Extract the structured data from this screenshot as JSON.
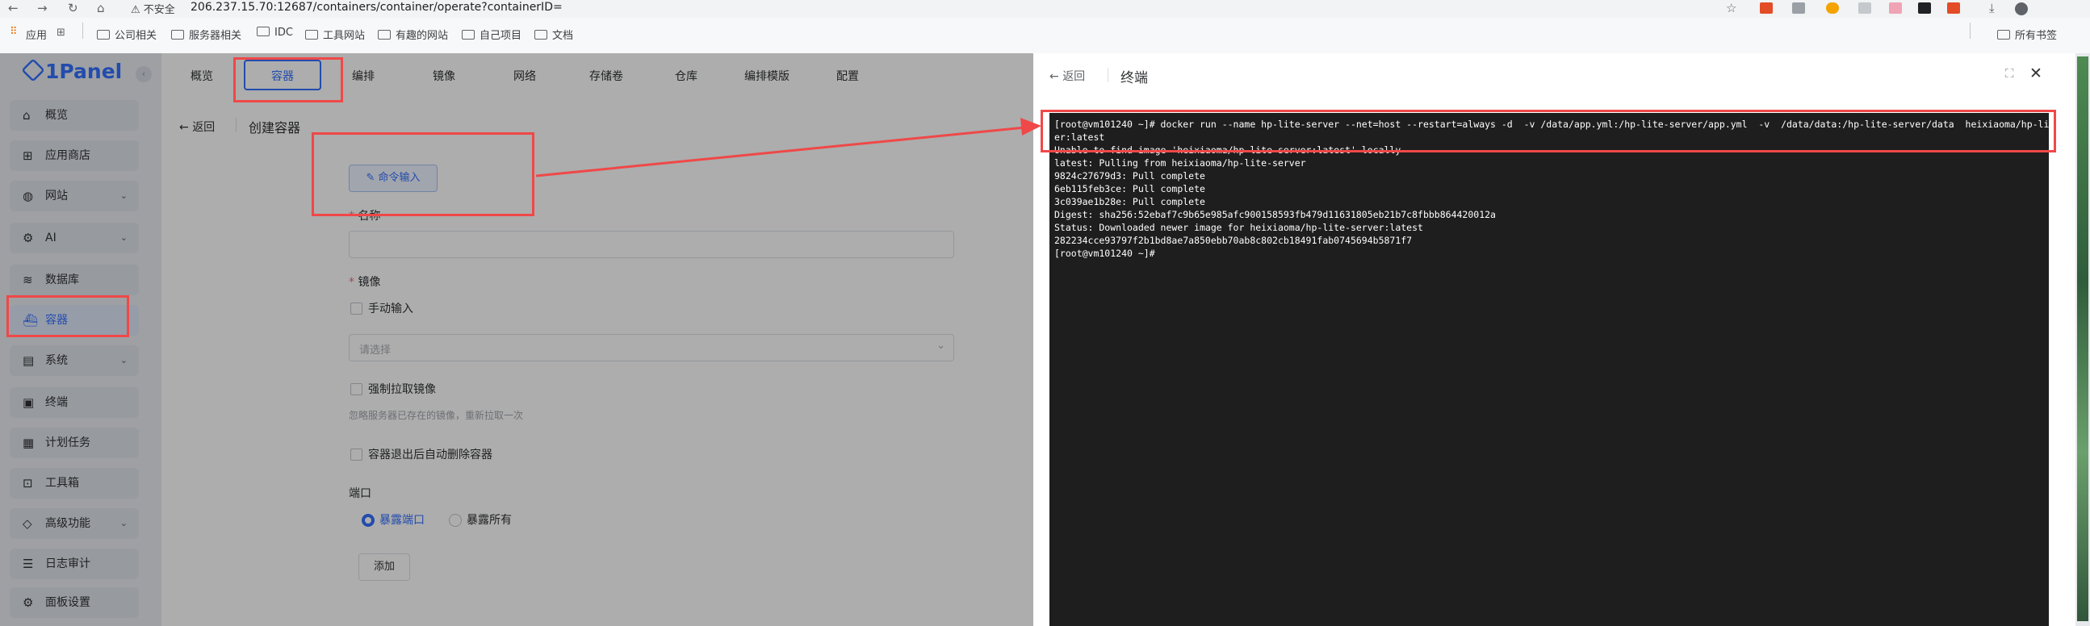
{
  "browser": {
    "insecure_label": "不安全",
    "url": "206.237.15.70:12687/containers/container/operate?containerID=",
    "bookmarks": [
      "应用",
      "公司相关",
      "服务器相关",
      "IDC",
      "工具网站",
      "有趣的网站",
      "自己项目",
      "文档"
    ],
    "all_bookmarks": "所有书签"
  },
  "sidebar": {
    "logo": "1Panel",
    "items": [
      {
        "label": "概览",
        "icon": "home-icon",
        "chevron": false
      },
      {
        "label": "应用商店",
        "icon": "apps-icon",
        "chevron": false
      },
      {
        "label": "网站",
        "icon": "globe-icon",
        "chevron": true
      },
      {
        "label": "AI",
        "icon": "robot-icon",
        "chevron": true
      },
      {
        "label": "数据库",
        "icon": "layers-icon",
        "chevron": false
      },
      {
        "label": "容器",
        "icon": "docker-icon",
        "chevron": false,
        "active": true
      },
      {
        "label": "系统",
        "icon": "system-icon",
        "chevron": true
      },
      {
        "label": "终端",
        "icon": "terminal-icon",
        "chevron": false
      },
      {
        "label": "计划任务",
        "icon": "calendar-icon",
        "chevron": false
      },
      {
        "label": "工具箱",
        "icon": "toolbox-icon",
        "chevron": false
      },
      {
        "label": "高级功能",
        "icon": "diamond-icon",
        "chevron": true
      },
      {
        "label": "日志审计",
        "icon": "log-icon",
        "chevron": false
      },
      {
        "label": "面板设置",
        "icon": "settings-icon",
        "chevron": false
      }
    ]
  },
  "tabs": [
    "概览",
    "容器",
    "编排",
    "镜像",
    "网络",
    "存储卷",
    "仓库",
    "编排模版",
    "配置"
  ],
  "page": {
    "back": "返回",
    "title": "创建容器",
    "command_button": "命令输入",
    "name_label": "名称",
    "image_label": "镜像",
    "manual_input": "手动输入",
    "select_placeholder": "请选择",
    "force_pull": "强制拉取镜像",
    "force_pull_hint": "忽略服务器已存在的镜像，重新拉取一次",
    "auto_remove": "容器退出后自动删除容器",
    "port_label": "端口",
    "expose_port": "暴露端口",
    "expose_all": "暴露所有",
    "add_button": "添加"
  },
  "drawer": {
    "back": "返回",
    "title": "终端",
    "terminal_lines": [
      "[root@vm101240 ~]# docker run --name hp-lite-server --net=host --restart=always -d  -v /data/app.yml:/hp-lite-server/app.yml  -v  /data/data:/hp-lite-server/data  heixiaoma/hp-lite-serv",
      "er:latest",
      "Unable to find image 'heixiaoma/hp-lite-server:latest' locally",
      "latest: Pulling from heixiaoma/hp-lite-server",
      "9824c27679d3: Pull complete",
      "6eb115feb3ce: Pull complete",
      "3c039ae1b28e: Pull complete",
      "Digest: sha256:52ebaf7c9b65e985afc900158593fb479d11631805eb21b7c8fbbb864420012a",
      "Status: Downloaded newer image for heixiaoma/hp-lite-server:latest",
      "282234cce93797f2b1bd8ae7a850ebb70ab8c802cb18491fab0745694b5871f7",
      "[root@vm101240 ~]#"
    ]
  },
  "colors": {
    "accent": "#3370ff",
    "annotation_red": "#f04848",
    "terminal_bg": "#1e1e1e"
  }
}
